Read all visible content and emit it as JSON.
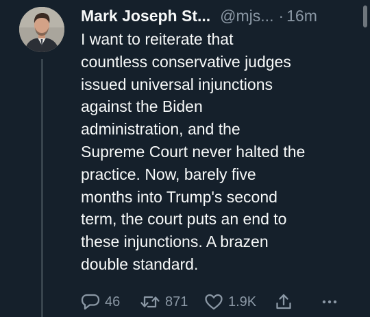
{
  "tweet": {
    "author_name": "Mark Joseph St...",
    "handle": "@mjs...",
    "separator": "·",
    "timestamp": "16m",
    "text": "I want to reiterate that\ncountless conservative judges\nissued universal injunctions\nagainst the Biden\nadministration, and the\nSupreme Court never halted the\npractice. Now, barely five\nmonths into Trump's second\nterm, the court puts an end to\nthese injunctions. A brazen\ndouble standard.",
    "avatar_icon": "user-avatar-photo"
  },
  "actions": {
    "reply": {
      "icon": "reply-icon",
      "count": "46"
    },
    "repost": {
      "icon": "repost-icon",
      "count": "871"
    },
    "like": {
      "icon": "heart-icon",
      "count": "1.9K"
    },
    "share": {
      "icon": "share-icon"
    },
    "more": {
      "icon": "more-icon"
    }
  },
  "colors": {
    "background": "#15202b",
    "text_primary": "#f7f9f9",
    "text_secondary": "#8b98a5",
    "thread_line": "#38444d"
  }
}
